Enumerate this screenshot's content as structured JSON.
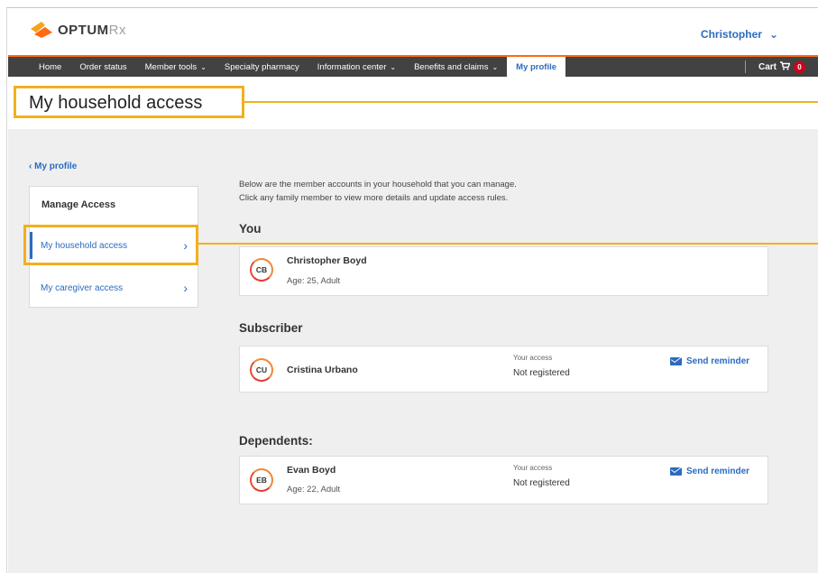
{
  "header": {
    "logo_text_main": "OPTUM",
    "logo_text_rx": "Rx",
    "user_name": "Christopher",
    "user_caret": "⌄"
  },
  "nav": {
    "items": [
      {
        "label": "Home",
        "caret": ""
      },
      {
        "label": "Order status",
        "caret": ""
      },
      {
        "label": "Member tools",
        "caret": "⌄"
      },
      {
        "label": "Specialty pharmacy",
        "caret": ""
      },
      {
        "label": "Information center",
        "caret": "⌄"
      },
      {
        "label": "Benefits and claims",
        "caret": "⌄"
      },
      {
        "label": "My profile",
        "caret": ""
      }
    ],
    "cart_label": "Cart",
    "cart_count": "0"
  },
  "page": {
    "title": "My household access",
    "back_link": "‹ My profile",
    "intro_line1": "Below are the member accounts in your household that you can manage.",
    "intro_line2": "Click any family member to view more details and update access rules."
  },
  "sidebar": {
    "heading": "Manage Access",
    "items": [
      {
        "label": "My household access",
        "chevron": "›"
      },
      {
        "label": "My caregiver access",
        "chevron": "›"
      }
    ]
  },
  "sections": {
    "you": "You",
    "subscriber": "Subscriber",
    "dependents": "Dependents:"
  },
  "members": {
    "you": {
      "initials": "CB",
      "name": "Christopher Boyd",
      "sub": "Age: 25, Adult"
    },
    "subscriber": {
      "initials": "CU",
      "name": "Cristina Urbano",
      "access_label": "Your access",
      "access_value": "Not registered",
      "reminder": "Send reminder"
    },
    "dependent": {
      "initials": "EB",
      "name": "Evan Boyd",
      "sub": "Age: 22, Adult",
      "access_label": "Your access",
      "access_value": "Not registered",
      "reminder": "Send reminder"
    }
  },
  "colors": {
    "brand_orange": "#ff6a13",
    "highlight_yellow": "#f2b01e",
    "link_blue": "#2b6bc0",
    "nav_bg": "#424242",
    "content_bg": "#efefef"
  }
}
